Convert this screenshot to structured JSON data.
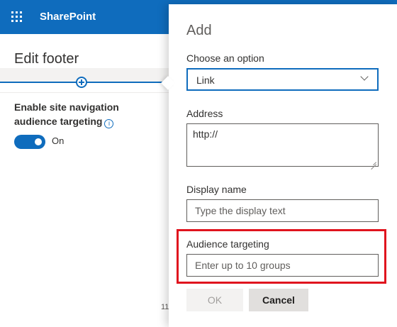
{
  "suite": {
    "app_name": "SharePoint"
  },
  "left_panel": {
    "title": "Edit footer",
    "nav_setting_label": "Enable site navigation audience targeting",
    "info_glyph": "i",
    "toggle_state": "On",
    "page_number_fragment": "11"
  },
  "add_panel": {
    "title": "Add",
    "choose_label": "Choose an option",
    "choose_value": "Link",
    "address_label": "Address",
    "address_value": "http://",
    "display_name_label": "Display name",
    "display_name_placeholder": "Type the display text",
    "audience_label": "Audience targeting",
    "audience_placeholder": "Enter up to 10 groups",
    "ok_label": "OK",
    "cancel_label": "Cancel"
  },
  "colors": {
    "brand": "#0f6cbd",
    "highlight": "#e0141e"
  },
  "icons": [
    "waffle-icon",
    "add-link-icon",
    "info-icon",
    "chevron-down-icon",
    "resize-grip-icon"
  ]
}
